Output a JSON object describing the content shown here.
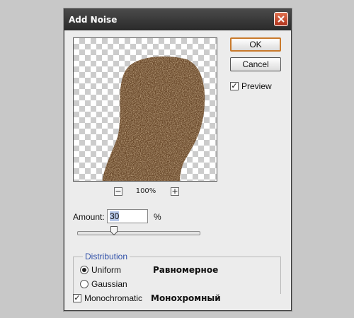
{
  "dialog": {
    "title": "Add Noise",
    "close_icon": "close-x-icon",
    "accent_color": "#c97a2c"
  },
  "buttons": {
    "ok_label": "OK",
    "cancel_label": "Cancel"
  },
  "preview": {
    "checkbox_label": "Preview",
    "checked": true,
    "zoom_level": "100%",
    "zoom_out_glyph": "−",
    "zoom_in_glyph": "+"
  },
  "amount": {
    "label": "Amount:",
    "value": "30",
    "unit": "%",
    "slider_fraction": 0.3
  },
  "distribution": {
    "title": "Distribution",
    "title_color": "#3050a8",
    "options": [
      {
        "label": "Uniform",
        "selected": true,
        "annotation": "Равномерное"
      },
      {
        "label": "Gaussian",
        "selected": false
      }
    ]
  },
  "monochromatic": {
    "label": "Monochromatic",
    "checked": true,
    "annotation": "Монохромный"
  }
}
